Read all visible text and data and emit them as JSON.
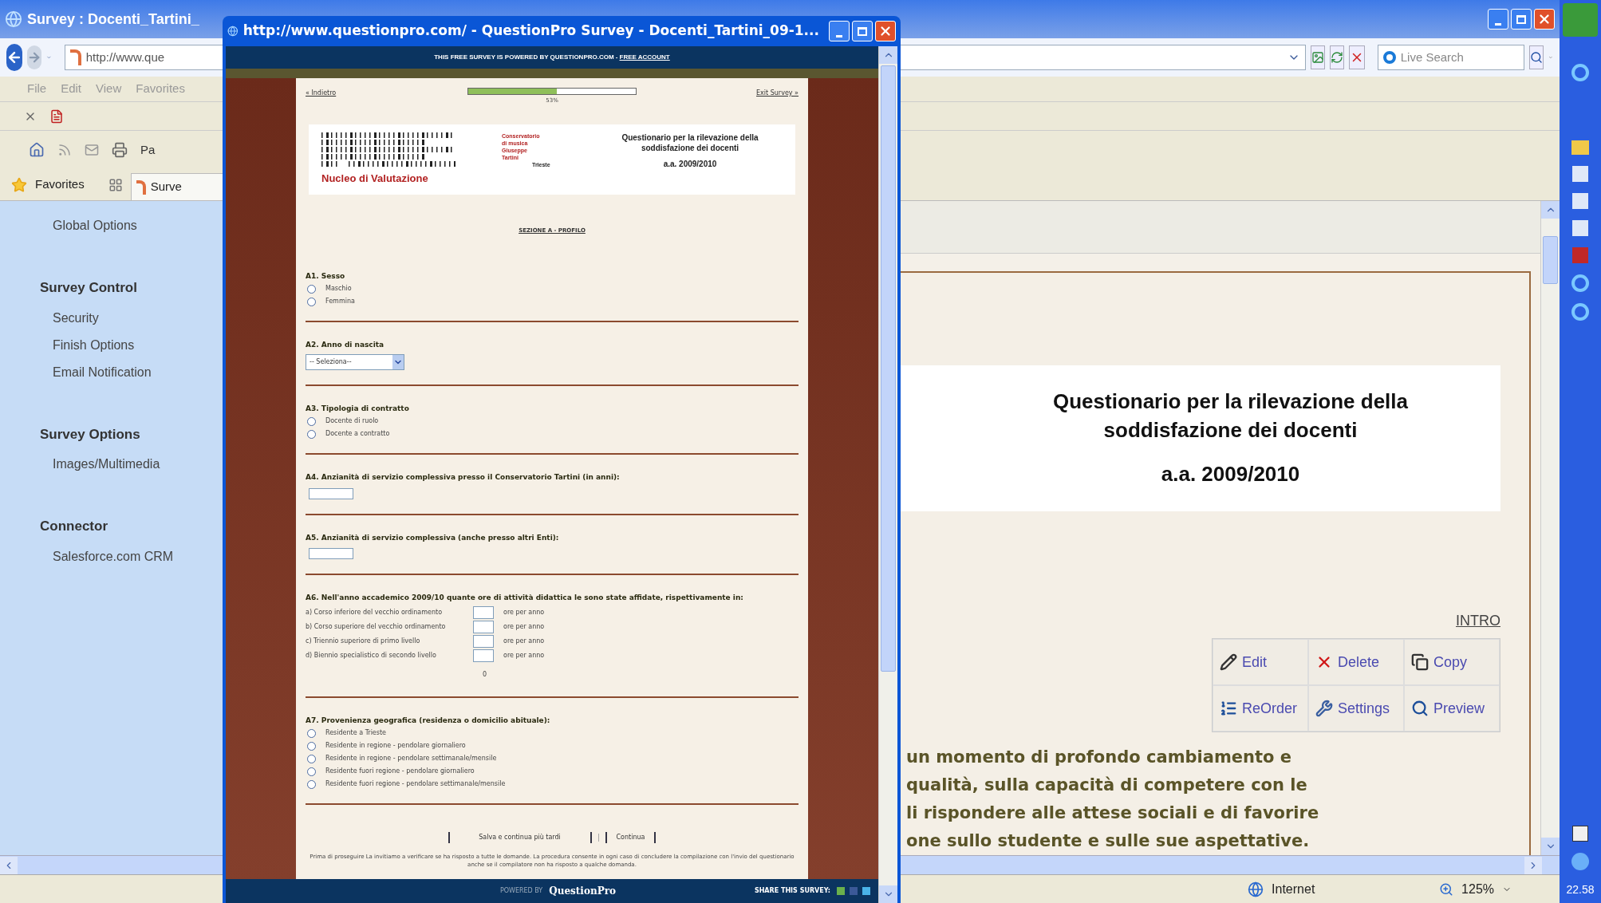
{
  "browser": {
    "title": "Survey : Docenti_Tartini_",
    "address": "http://www.que",
    "search_placeholder": "Live Search",
    "menu": [
      "File",
      "Edit",
      "View",
      "Favorites"
    ],
    "command_label": "Pa",
    "favorites_label": "Favorites",
    "tab_label": "Surve"
  },
  "sidebar": {
    "items": [
      {
        "label": "Global Options",
        "kind": "link"
      },
      {
        "label": "Survey Control",
        "kind": "heading"
      },
      {
        "label": "Security",
        "kind": "link"
      },
      {
        "label": "Finish Options",
        "kind": "link"
      },
      {
        "label": "Email Notification",
        "kind": "link"
      },
      {
        "label": "Survey Options",
        "kind": "heading"
      },
      {
        "label": "Images/Multimedia",
        "kind": "link"
      },
      {
        "label": "Connector",
        "kind": "heading"
      },
      {
        "label": "Salesforce.com CRM",
        "kind": "link"
      }
    ]
  },
  "content": {
    "title_lines": [
      "Questionario per la rilevazione della",
      "soddisfazione dei docenti"
    ],
    "year": "a.a. 2009/2010",
    "intro_link": "INTRO",
    "actions": [
      {
        "label": "Edit",
        "kind": "edit"
      },
      {
        "label": "Delete",
        "kind": "delete"
      },
      {
        "label": "Copy",
        "kind": "copy"
      },
      {
        "label": "ReOrder",
        "kind": "reorder"
      },
      {
        "label": "Settings",
        "kind": "settings"
      },
      {
        "label": "Preview",
        "kind": "preview"
      }
    ],
    "paragraph_lines": [
      "un momento di profondo cambiamento e",
      "qualità, sulla capacità di competere con le",
      "li rispondere alle attese sociali e di favorire",
      "one sullo studente e sulle sue aspettative."
    ]
  },
  "status_bar": {
    "zone": "Internet",
    "zoom": "125%"
  },
  "taskbar": {
    "clock": "22.58"
  },
  "popup": {
    "title": "http://www.questionpro.com/ - QuestionPro Survey - Docenti_Tartini_09-1...",
    "banner": "THIS FREE SURVEY IS POWERED BY QUESTIONPRO.COM - ",
    "banner_link": "FREE ACCOUNT",
    "back_link": "« Indietro",
    "exit_link": "Exit Survey »",
    "progress": {
      "level": 0.53,
      "label": "53%"
    },
    "header": {
      "org_lines": [
        "Conservatorio",
        "di musica",
        "Giuseppe",
        "Tartini"
      ],
      "city": "Trieste",
      "unit": "Nucleo di Valutazione",
      "title_lines": [
        "Questionario per la rilevazione della",
        "soddisfazione dei docenti"
      ],
      "year": "a.a. 2009/2010"
    },
    "section": "SEZIONE A - PROFILO",
    "questions": [
      {
        "kind": "radio",
        "label": "A1. Sesso",
        "options": [
          {
            "label": "Maschio",
            "selected": false
          },
          {
            "label": "Femmina",
            "selected": false
          }
        ]
      },
      {
        "kind": "select",
        "label": "A2. Anno di nascita",
        "value": "-- Seleziona--"
      },
      {
        "kind": "radio",
        "label": "A3. Tipologia di contratto",
        "options": [
          {
            "label": "Docente di ruolo",
            "selected": false
          },
          {
            "label": "Docente a contratto",
            "selected": false
          }
        ]
      },
      {
        "kind": "text",
        "label": "A4. Anzianità di servizio complessiva presso il Conservatorio Tartini (in anni):"
      },
      {
        "kind": "text",
        "label": "A5. Anzianità di servizio complessiva (anche presso altri Enti):"
      },
      {
        "kind": "grid",
        "label": "A6. Nell'anno accademico 2009/10 quante ore di attività didattica le sono state affidate, rispettivamente in:",
        "rows": [
          {
            "label": "a) Corso inferiore del vecchio ordinamento",
            "unit": "ore per anno"
          },
          {
            "label": "b) Corso superiore del vecchio ordinamento",
            "unit": "ore per anno"
          },
          {
            "label": "c) Triennio superiore di primo livello",
            "unit": "ore per anno"
          },
          {
            "label": "d) Biennio specialistico di secondo livello",
            "unit": "ore per anno"
          }
        ],
        "total": "0"
      },
      {
        "kind": "radio",
        "label": "A7. Provenienza geografica (residenza o domicilio abituale):",
        "options": [
          {
            "label": "Residente a Trieste",
            "selected": false
          },
          {
            "label": "Residente in regione - pendolare giornaliero",
            "selected": false
          },
          {
            "label": "Residente in regione - pendolare settimanale/mensile",
            "selected": false
          },
          {
            "label": "Residente fuori regione - pendolare giornaliero",
            "selected": false
          },
          {
            "label": "Residente fuori regione - pendolare settimanale/mensile",
            "selected": false
          }
        ]
      }
    ],
    "buttons": [
      "Salva e continua più tardi",
      "Continua"
    ],
    "note": "Prima di proseguire La invitiamo a verificare se ha risposto a tutte le domande. La procedura consente in ogni caso di concludere la compilazione con l'invio del questionario anche se il compilatore non ha risposto a qualche domanda.",
    "footer": {
      "powered": "POWERED BY",
      "brand": "QuestionPro",
      "share": "SHARE THIS SURVEY:"
    }
  }
}
